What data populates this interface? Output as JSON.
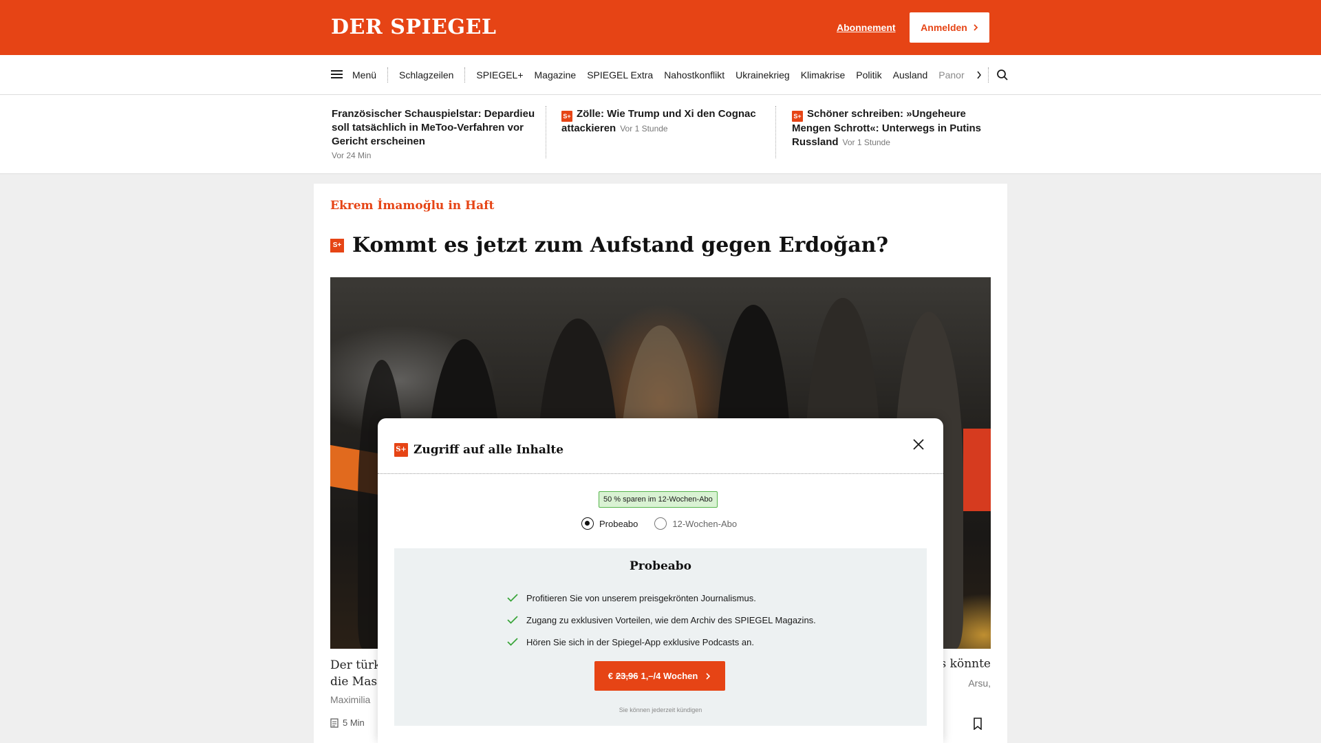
{
  "header": {
    "logo": "DER SPIEGEL",
    "subscription_link": "Abonnement",
    "login_button": "Anmelden"
  },
  "nav": {
    "menu_label": "Menü",
    "items": [
      "Schlagzeilen",
      "SPIEGEL+",
      "Magazine",
      "SPIEGEL Extra",
      "Nahostkonflikt",
      "Ukrainekrieg",
      "Klimakrise",
      "Politik",
      "Ausland",
      "Panor"
    ]
  },
  "headlines": [
    {
      "title": "Französischer Schauspielstar: Depardieu soll tatsächlich in MeToo-Verfahren vor Gericht erscheinen",
      "time": "Vor 24 Min",
      "plus": false
    },
    {
      "title": "Zölle: Wie Trump und Xi den Cognac attackieren",
      "time": "Vor 1 Stunde",
      "plus": true
    },
    {
      "title": "Schöner schreiben: »Ungeheure Mengen Schrott«: Unterwegs in Putins Russland",
      "time": "Vor 1 Stunde",
      "plus": true
    }
  ],
  "article": {
    "kicker": "Ekrem İmamoğlu in Haft",
    "headline": "Kommt es jetzt zum Aufstand gegen Erdoğan?",
    "badge": "S+",
    "lead_left_1": "Der türk",
    "lead_left_2": "die Mass",
    "lead_right": "s könnte",
    "author_left": "Maximilia",
    "author_right": "Arsu,",
    "read_time": "5 Min"
  },
  "modal": {
    "badge": "S+",
    "title": "Zugriff auf alle Inhalte",
    "savings_badge": "50 % sparen im 12-Wochen-Abo",
    "options": [
      {
        "label": "Probeabo",
        "selected": true
      },
      {
        "label": "12-Wochen-Abo",
        "selected": false
      }
    ],
    "offer_title": "Probeabo",
    "benefits": [
      "Profitieren Sie von unserem preisgekrönten Journalismus.",
      "Zugang zu exklusiven Vorteilen, wie dem Archiv des SPIEGEL Magazins.",
      "Hören Sie sich in der Spiegel-App exklusive Podcasts an."
    ],
    "cta_currency": "€",
    "cta_old_price": "23,96",
    "cta_new_price": "1,–/4 Wochen",
    "cancel_note": "Sie können jederzeit kündigen"
  },
  "colors": {
    "brand": "#e64415",
    "check": "#3aa53a"
  },
  "icons": [
    "hamburger-icon",
    "chevron-right-icon",
    "search-icon",
    "close-icon",
    "check-icon",
    "bookmark-icon",
    "article-icon"
  ]
}
